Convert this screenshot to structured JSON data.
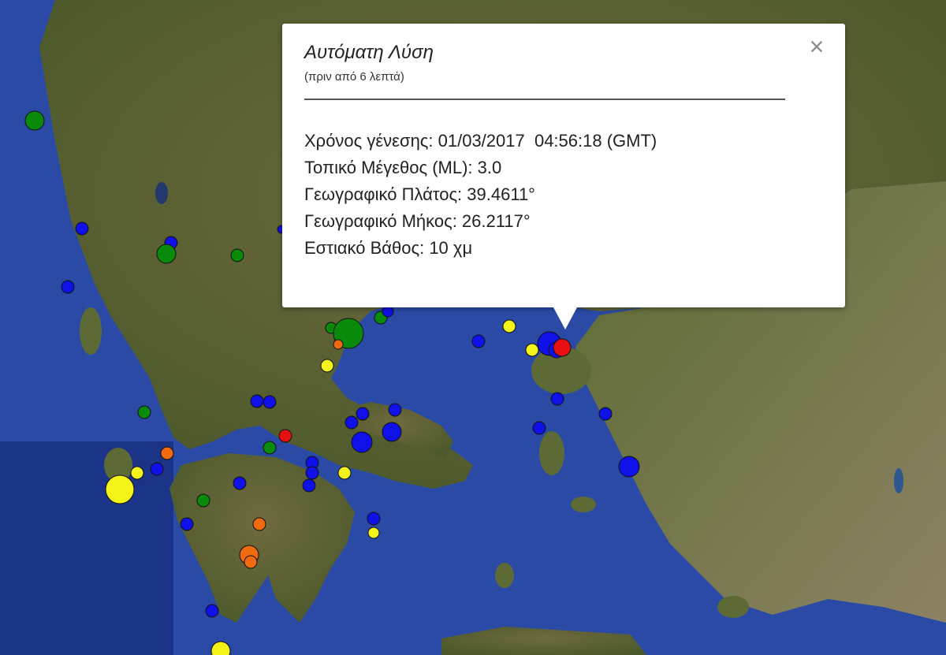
{
  "popup": {
    "title": "Αυτόματη Λύση",
    "subtitle": "(πριν από 6 λεπτά)",
    "close_icon": "×",
    "rows": [
      "Χρόνος γένεσης: 01/03/2017  04:56:18 (GMT)",
      "Τοπικό Μέγεθος (ML): 3.0",
      "Γεωγραφικό Πλάτος: 39.4611°",
      "Γεωγραφικό Μήκος: 26.2117°",
      "Εστιακό Βάθος: 10 χμ"
    ]
  },
  "map": {
    "colors": {
      "sea": "#2a4aa6",
      "deep_sea": "#1c3488",
      "land": "#53602f",
      "land_highlight": "#7d7a4c",
      "land_dry": "#8b8163"
    },
    "marker_colors": {
      "blue": "#1010e8",
      "green": "#0a8a0a",
      "yellow": "#f4f41a",
      "orange": "#f06a10",
      "red": "#e81010"
    },
    "selected_marker_color": "red",
    "marker_legend_counts": {
      "blue": 36,
      "green": 9,
      "yellow": 9,
      "orange": 5,
      "red": 2
    }
  }
}
